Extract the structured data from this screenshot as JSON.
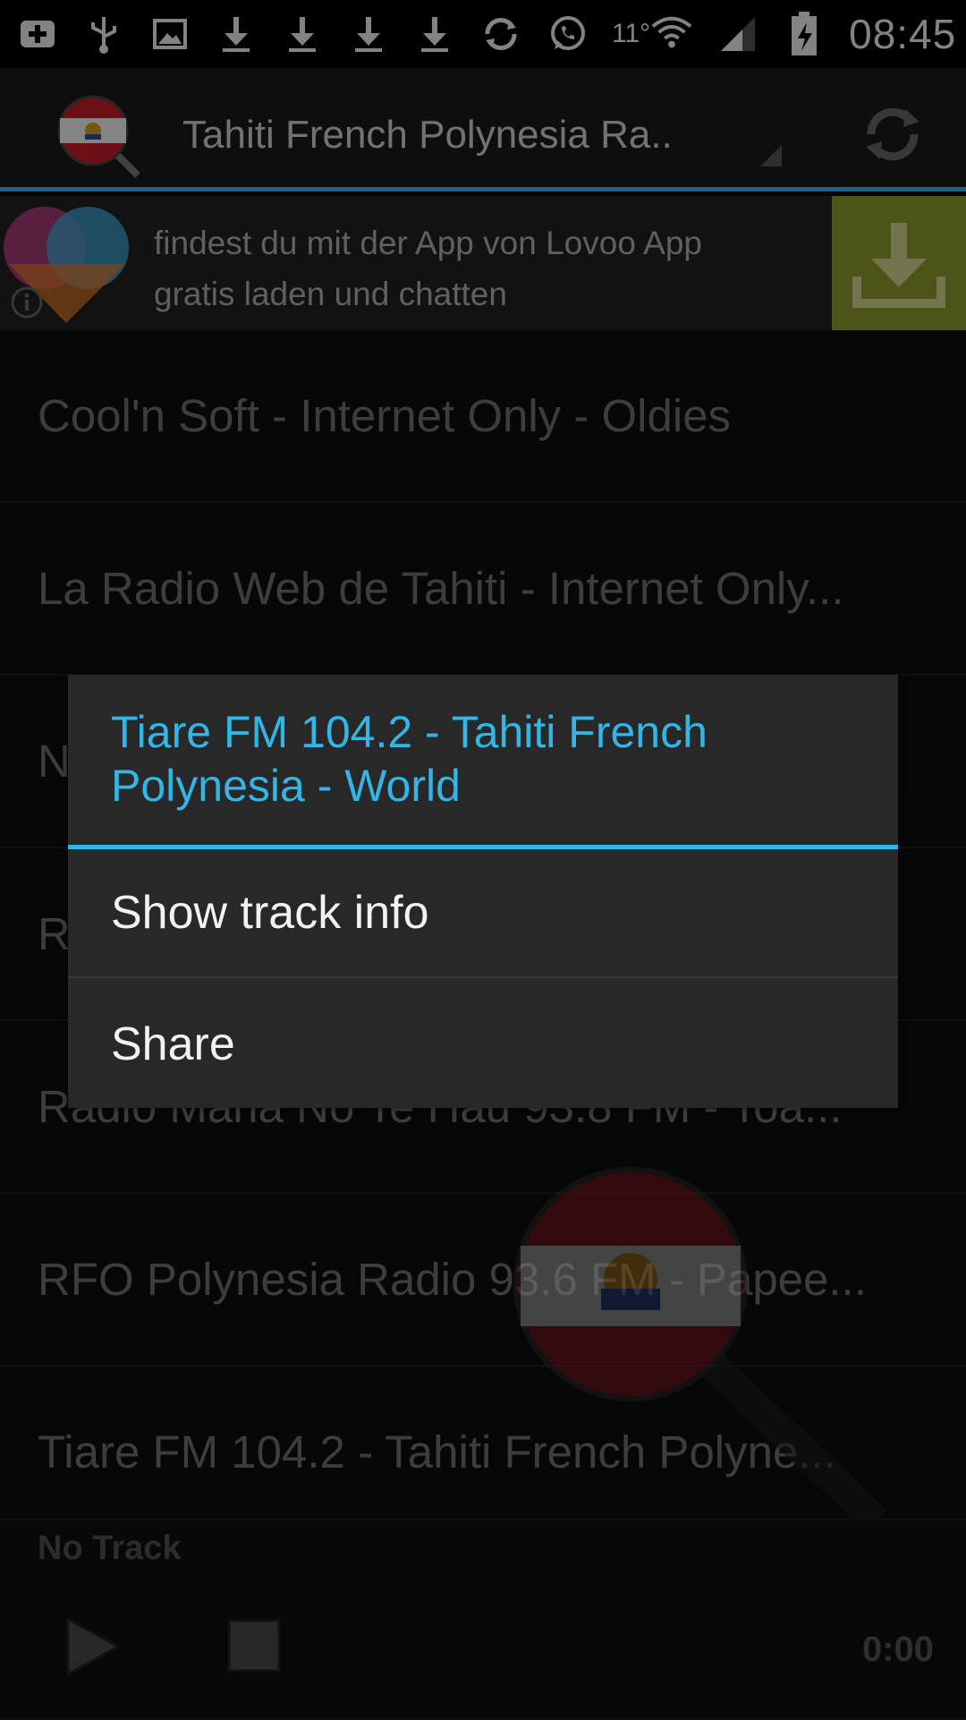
{
  "status_bar": {
    "temperature": "11°",
    "time": "08:45"
  },
  "action_bar": {
    "station_title": "Tahiti French Polynesia Ra.."
  },
  "ad": {
    "text": "findest du mit der App von Lovoo App gratis laden und chatten",
    "colors": {
      "download_bg": "#8c9a2a"
    }
  },
  "list": {
    "items": [
      {
        "label": "Cool'n Soft - Internet Only - Oldies"
      },
      {
        "label": "La Radio Web de Tahiti - Internet Only..."
      },
      {
        "label": "N"
      },
      {
        "label": "R"
      },
      {
        "label": "Radio Maria No Te Hau 93.8 FM - Toa..."
      },
      {
        "label": "RFO Polynesia Radio 93.6 FM - Papee..."
      },
      {
        "label": "Tiare FM 104.2 - Tahiti French Polyne..."
      }
    ]
  },
  "dialog": {
    "title": "Tiare FM 104.2 - Tahiti French Polynesia - World",
    "options": [
      {
        "label": "Show track info"
      },
      {
        "label": "Share"
      }
    ]
  },
  "player": {
    "track_label": "No Track",
    "time": "0:00"
  },
  "colors": {
    "accent": "#33b5e5",
    "background": "#0e0e0e"
  }
}
